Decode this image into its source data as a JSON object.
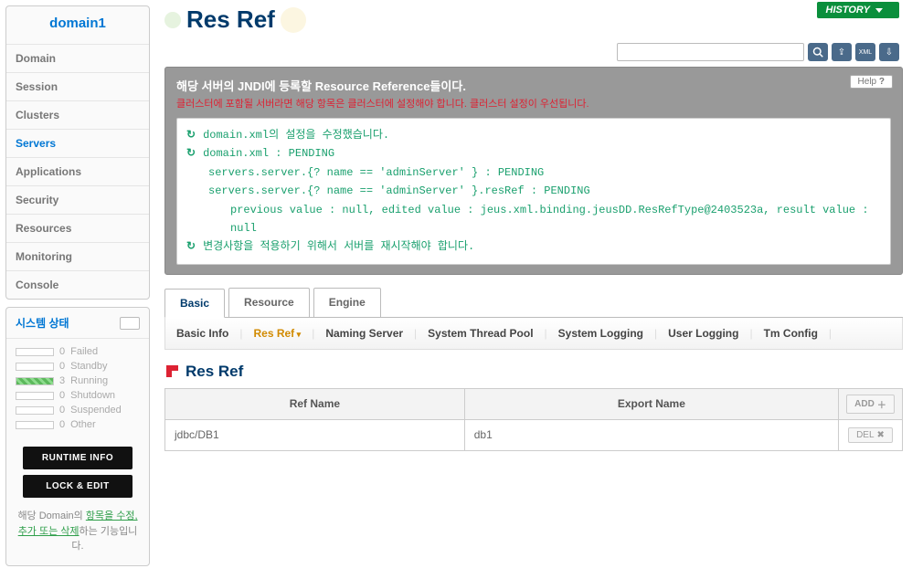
{
  "header": {
    "history_label": "HISTORY",
    "page_title": "Res Ref"
  },
  "sidebar": {
    "domain_title": "domain1",
    "nav": [
      {
        "label": "Domain",
        "active": false
      },
      {
        "label": "Session",
        "active": false
      },
      {
        "label": "Clusters",
        "active": false
      },
      {
        "label": "Servers",
        "active": true
      },
      {
        "label": "Applications",
        "active": false
      },
      {
        "label": "Security",
        "active": false
      },
      {
        "label": "Resources",
        "active": false
      },
      {
        "label": "Monitoring",
        "active": false
      },
      {
        "label": "Console",
        "active": false
      }
    ],
    "system_state_title": "시스템 상태",
    "states": [
      {
        "count": "0",
        "label": "Failed",
        "running": false
      },
      {
        "count": "0",
        "label": "Standby",
        "running": false
      },
      {
        "count": "3",
        "label": "Running",
        "running": true
      },
      {
        "count": "0",
        "label": "Shutdown",
        "running": false
      },
      {
        "count": "0",
        "label": "Suspended",
        "running": false
      },
      {
        "count": "0",
        "label": "Other",
        "running": false
      }
    ],
    "runtime_btn": "RUNTIME INFO",
    "lock_btn": "LOCK & EDIT",
    "note_prefix": "해당 Domain의 ",
    "note_link": "항목을 수정, 추가 또는 삭제",
    "note_suffix": "하는 기능입니다."
  },
  "toolbar": {
    "search_placeholder": ""
  },
  "info_panel": {
    "headline": "해당 서버의 JNDI에 등록할 Resource Reference들이다.",
    "subline": "클러스터에 포함될 서버라면 해당 항목은 클러스터에 설정해야 합니다. 클러스터 설정이 우선됩니다.",
    "help_label": "Help"
  },
  "log": {
    "l1": "domain.xml의 설정을 수정했습니다.",
    "l2": "domain.xml : PENDING",
    "l3": "servers.server.{? name == 'adminServer' } : PENDING",
    "l4": "servers.server.{? name == 'adminServer' }.resRef : PENDING",
    "l5": "previous value : null, edited value : jeus.xml.binding.jeusDD.ResRefType@2403523a, result value : null",
    "l6": "변경사항을 적용하기 위해서 서버를 재시작해야 합니다."
  },
  "tabs": {
    "basic": "Basic",
    "resource": "Resource",
    "engine": "Engine"
  },
  "subtabs": {
    "basic_info": "Basic Info",
    "res_ref": "Res Ref",
    "naming_server": "Naming Server",
    "system_thread_pool": "System Thread Pool",
    "system_logging": "System Logging",
    "user_logging": "User Logging",
    "tm_config": "Tm Config"
  },
  "section": {
    "title": "Res Ref"
  },
  "table": {
    "col_ref_name": "Ref Name",
    "col_export_name": "Export Name",
    "add_btn": "ADD",
    "del_btn": "DEL",
    "rows": [
      {
        "ref_name": "jdbc/DB1",
        "export_name": "db1"
      }
    ]
  }
}
